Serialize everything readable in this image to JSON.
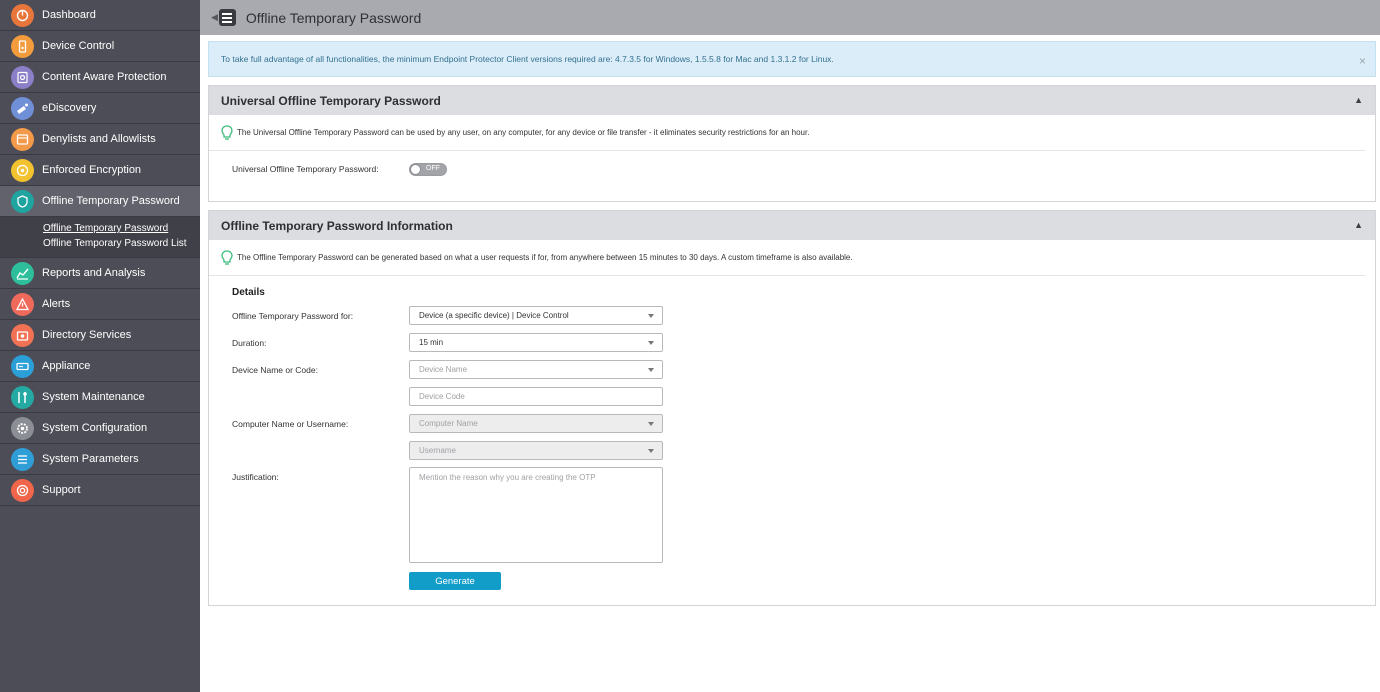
{
  "sidebar": {
    "items": [
      {
        "label": "Dashboard",
        "icon": "dashboard-icon",
        "color": "#e8763a"
      },
      {
        "label": "Device Control",
        "icon": "device-control-icon",
        "color": "#f39c3d"
      },
      {
        "label": "Content Aware Protection",
        "icon": "content-aware-icon",
        "color": "#8b7fc8"
      },
      {
        "label": "eDiscovery",
        "icon": "ediscovery-icon",
        "color": "#6f8fd6"
      },
      {
        "label": "Denylists and Allowlists",
        "icon": "denylists-icon",
        "color": "#f2994a"
      },
      {
        "label": "Enforced Encryption",
        "icon": "encryption-icon",
        "color": "#f2c230"
      },
      {
        "label": "Offline Temporary Password",
        "icon": "otp-icon",
        "color": "#1fa4a0"
      },
      {
        "label": "Reports and Analysis",
        "icon": "reports-icon",
        "color": "#2dbf9b"
      },
      {
        "label": "Alerts",
        "icon": "alerts-icon",
        "color": "#ef6a5b"
      },
      {
        "label": "Directory Services",
        "icon": "directory-icon",
        "color": "#f07153"
      },
      {
        "label": "Appliance",
        "icon": "appliance-icon",
        "color": "#2a9fd8"
      },
      {
        "label": "System Maintenance",
        "icon": "maintenance-icon",
        "color": "#24a9a3"
      },
      {
        "label": "System Configuration",
        "icon": "configuration-icon",
        "color": "#8c8e95"
      },
      {
        "label": "System Parameters",
        "icon": "parameters-icon",
        "color": "#2f9ed6"
      },
      {
        "label": "Support",
        "icon": "support-icon",
        "color": "#f0664a"
      }
    ],
    "submenu": [
      "Offline Temporary Password",
      "Offline Temporary Password List"
    ]
  },
  "header": {
    "title": "Offline Temporary Password"
  },
  "alert": {
    "text": "To take full advantage of all functionalities, the minimum Endpoint Protector Client versions required are: 4.7.3.5 for Windows, 1.5.5.8 for Mac and 1.3.1.2 for Linux.",
    "close": "×"
  },
  "universal": {
    "title": "Universal Offline Temporary Password",
    "hint": "The Universal Offline Temporary Password can be used by any user, on any computer, for any device or file transfer - it eliminates security restrictions for an hour.",
    "label": "Universal Offline Temporary Password:",
    "toggle_state": "OFF"
  },
  "info": {
    "title": "Offline Temporary Password Information",
    "hint": "The Offline Temporary Password can be generated based on what a user requests if for, from anywhere between 15 minutes to 30 days. A custom timeframe is also available.",
    "details_heading": "Details",
    "for_label": "Offline Temporary Password for:",
    "for_value": "Device (a specific device) | Device Control",
    "duration_label": "Duration:",
    "duration_value": "15 min",
    "device_label": "Device Name or Code:",
    "device_name_ph": "Device Name",
    "device_code_ph": "Device Code",
    "computer_label": "Computer Name or Username:",
    "computer_name_ph": "Computer Name",
    "username_ph": "Username",
    "justification_label": "Justification:",
    "justification_ph": "Mention the reason why you are creating the OTP",
    "generate_label": "Generate"
  }
}
